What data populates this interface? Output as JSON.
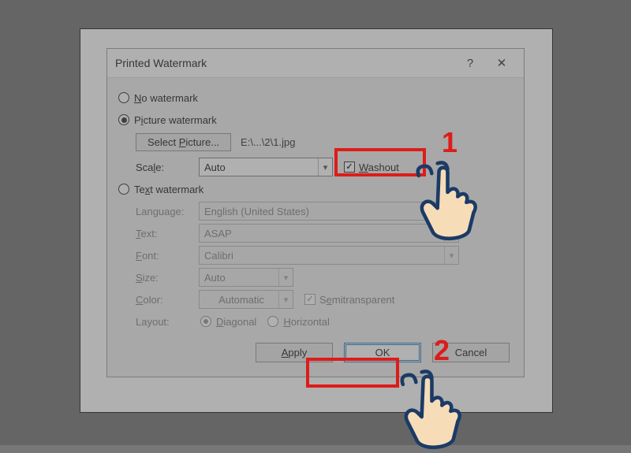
{
  "dialog": {
    "title": "Printed Watermark",
    "help_icon": "?",
    "close_icon": "✕",
    "no_watermark_label": "No watermark",
    "picture_watermark_label": "Picture watermark",
    "select_picture_label": "Select Picture...",
    "picture_path": "E:\\...\\2\\1.jpg",
    "scale_label": "Scale:",
    "scale_value": "Auto",
    "washout_label": "Washout",
    "text_watermark_label": "Text watermark",
    "language_label": "Language:",
    "language_value": "English (United States)",
    "text_label": "Text:",
    "text_value": "ASAP",
    "font_label": "Font:",
    "font_value": "Calibri",
    "size_label": "Size:",
    "size_value": "Auto",
    "color_label": "Color:",
    "color_value": "Automatic",
    "semitransparent_label": "Semitransparent",
    "layout_label": "Layout:",
    "layout_diagonal": "Diagonal",
    "layout_horizontal": "Horizontal",
    "apply": "Apply",
    "ok": "OK",
    "cancel": "Cancel"
  },
  "annotations": {
    "step1": "1",
    "step2": "2"
  }
}
